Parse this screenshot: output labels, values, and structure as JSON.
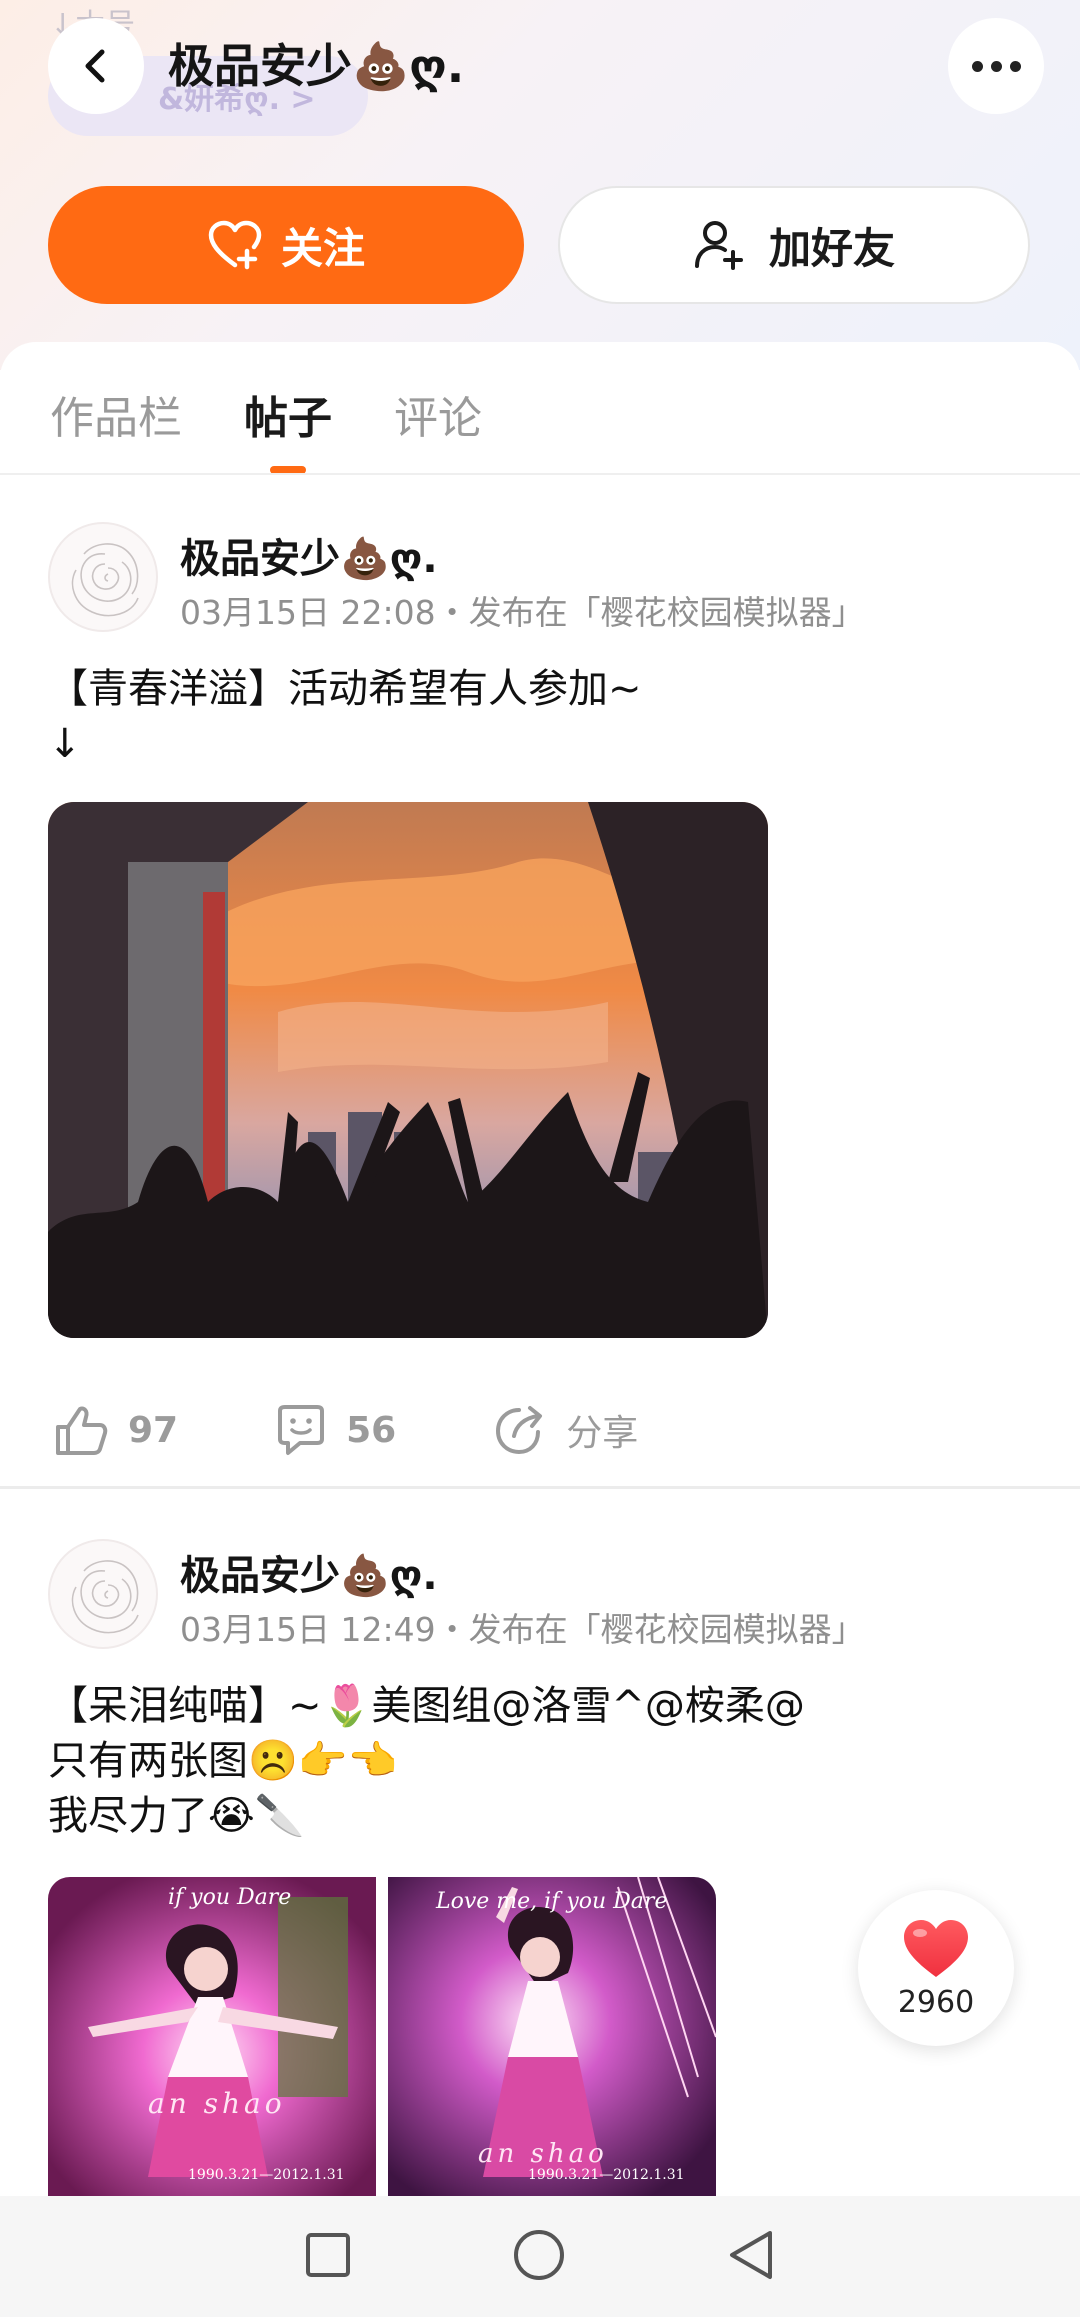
{
  "header": {
    "faded_under_text": "↓木号",
    "faded_chip_text": "&妍希ღ. >",
    "title": "极品安少💩ღ."
  },
  "actions_bar": {
    "follow_label": "关注",
    "add_friend_label": "加好友"
  },
  "tabs": [
    {
      "label": "作品栏",
      "active": false
    },
    {
      "label": "帖子",
      "active": true
    },
    {
      "label": "评论",
      "active": false
    }
  ],
  "posts": [
    {
      "author": "极品安少💩ღ.",
      "meta": "03月15日 22:08・发布在「樱花校园模拟器」",
      "text": "【青春洋溢】活动希望有人参加~\n↓",
      "likes": "97",
      "comments": "56",
      "share_label": "分享"
    },
    {
      "author": "极品安少💩ღ.",
      "meta": "03月15日 12:49・发布在「樱花校园模拟器」",
      "text": "【呆泪纯喵】~🌷美图组@洛雪^@桉柔@\n只有两张图☹️👉👈\n我尽力了😭🔪",
      "image_captions": [
        {
          "script": "if you Dare",
          "name": "an shao",
          "dates": "1990.3.21—2012.1.31"
        },
        {
          "script": "Love me, if you Dare",
          "name": "an shao",
          "dates": "1990.3.21—2012.1.31"
        }
      ]
    }
  ],
  "floating_like": {
    "count": "2960"
  },
  "colors": {
    "accent": "#ff6a13",
    "like_red": "#ff3b4a"
  }
}
